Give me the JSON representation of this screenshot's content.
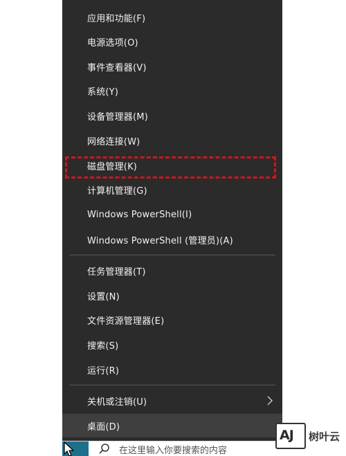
{
  "menu": {
    "group1": [
      {
        "label": "应用和功能(F)"
      },
      {
        "label": "电源选项(O)"
      },
      {
        "label": "事件查看器(V)"
      },
      {
        "label": "系统(Y)"
      },
      {
        "label": "设备管理器(M)"
      },
      {
        "label": "网络连接(W)"
      },
      {
        "label": "磁盘管理(K)"
      },
      {
        "label": "计算机管理(G)"
      },
      {
        "label": "Windows PowerShell(I)"
      },
      {
        "label": "Windows PowerShell (管理员)(A)"
      }
    ],
    "group2": [
      {
        "label": "任务管理器(T)"
      },
      {
        "label": "设置(N)"
      },
      {
        "label": "文件资源管理器(E)"
      },
      {
        "label": "搜索(S)"
      },
      {
        "label": "运行(R)"
      }
    ],
    "group3": [
      {
        "label": "关机或注销(U)",
        "icon": "chevron-right-icon"
      },
      {
        "label": "桌面(D)"
      }
    ],
    "highlighted_item": "磁盘管理(K)",
    "hovered_item": "桌面(D)"
  },
  "taskbar": {
    "search_placeholder": "在这里输入你要搜索的内容",
    "search_icon": "search-icon"
  },
  "watermark": {
    "logo_text": "AJ",
    "name": "树叶云"
  },
  "colors": {
    "menu_bg": "#2b2b2b",
    "menu_text": "#f2f2f2",
    "hover_bg": "#3f3f3f",
    "highlight_border": "#d0161c",
    "separator": "#585858"
  }
}
